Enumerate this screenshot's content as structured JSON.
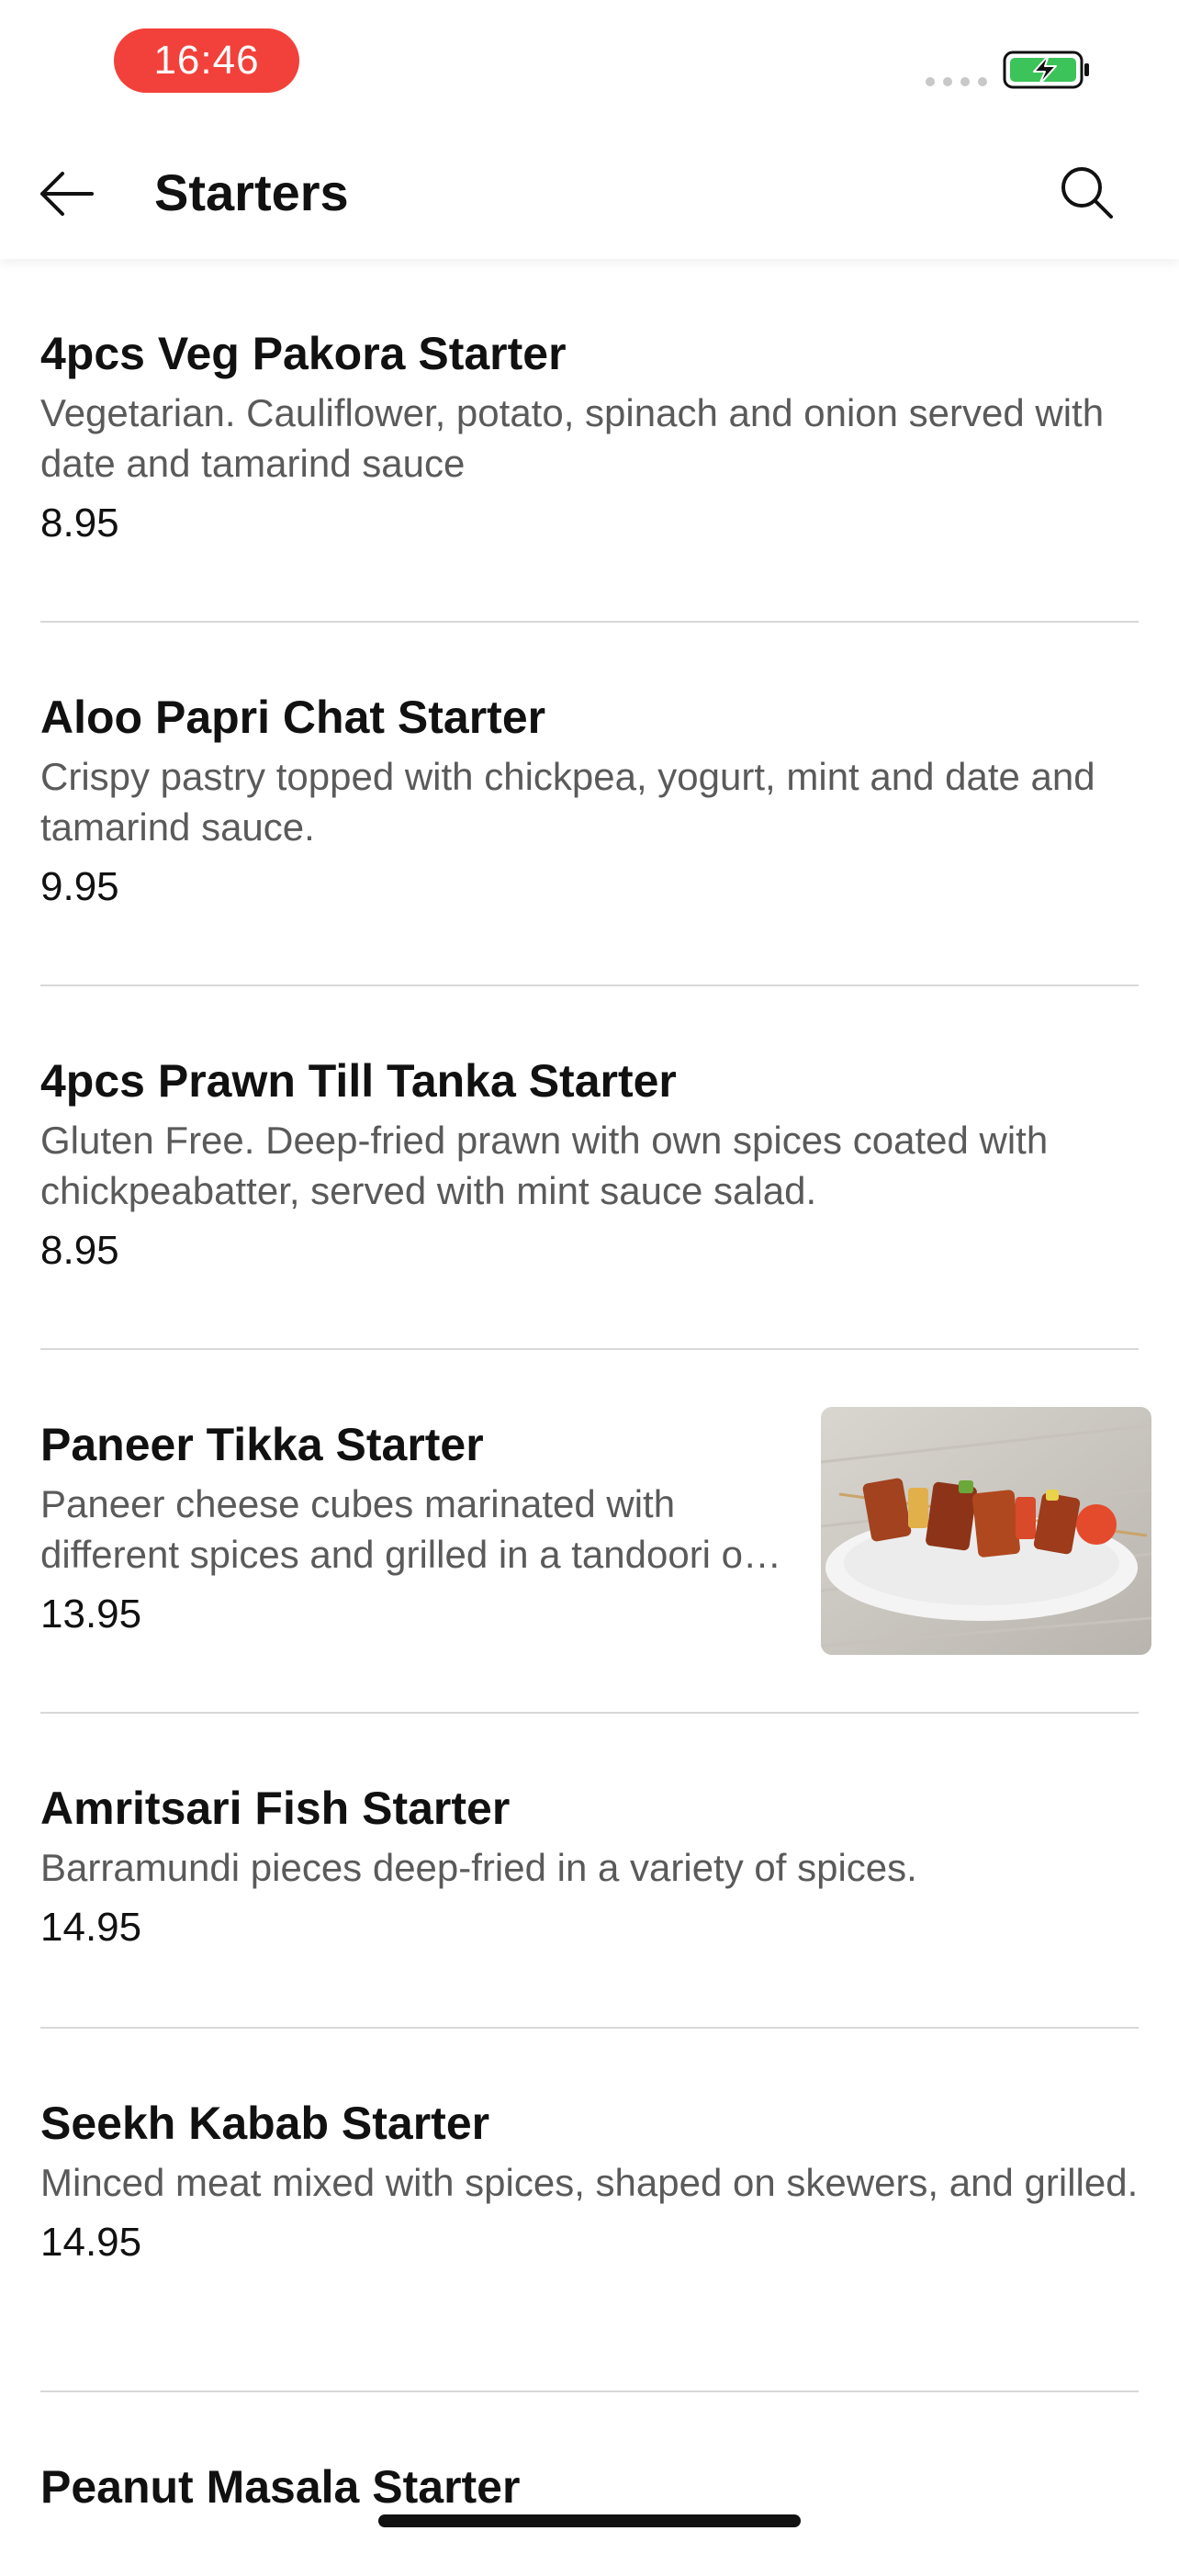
{
  "status_bar": {
    "time": "16:46",
    "time_pill_color": "#f2413a",
    "battery_icon": "battery-charging-icon",
    "battery_color": "#3cc45a"
  },
  "nav": {
    "title": "Starters",
    "back_icon": "arrow-left-icon",
    "search_icon": "search-icon"
  },
  "items": [
    {
      "name": "4pcs Veg Pakora Starter",
      "description": "Vegetarian. Cauliflower, potato, spinach and onion served with date and tamarind sauce",
      "price": "8.95"
    },
    {
      "name": "Aloo Papri Chat Starter",
      "description": "Crispy pastry topped with chickpea, yogurt, mint and date and tamarind sauce.",
      "price": "9.95"
    },
    {
      "name": "4pcs Prawn Till Tanka Starter",
      "description": "Gluten Free. Deep-fried prawn with own spices coated with chickpeabatter, served with mint sauce salad.",
      "price": "8.95"
    },
    {
      "name": "Paneer Tikka Starter",
      "description": "Paneer cheese cubes marinated with different spices and grilled in a tandoori o…",
      "price": "13.95",
      "image": "paneer-tikka-photo"
    },
    {
      "name": "Amritsari Fish Starter",
      "description": "Barramundi pieces deep-fried in a variety of spices.",
      "price": "14.95"
    },
    {
      "name": "Seekh Kabab Starter",
      "description": "Minced meat mixed with spices, shaped on skewers, and grilled.",
      "price": "14.95"
    },
    {
      "name": "Peanut Masala Starter",
      "description": "",
      "price": ""
    }
  ]
}
